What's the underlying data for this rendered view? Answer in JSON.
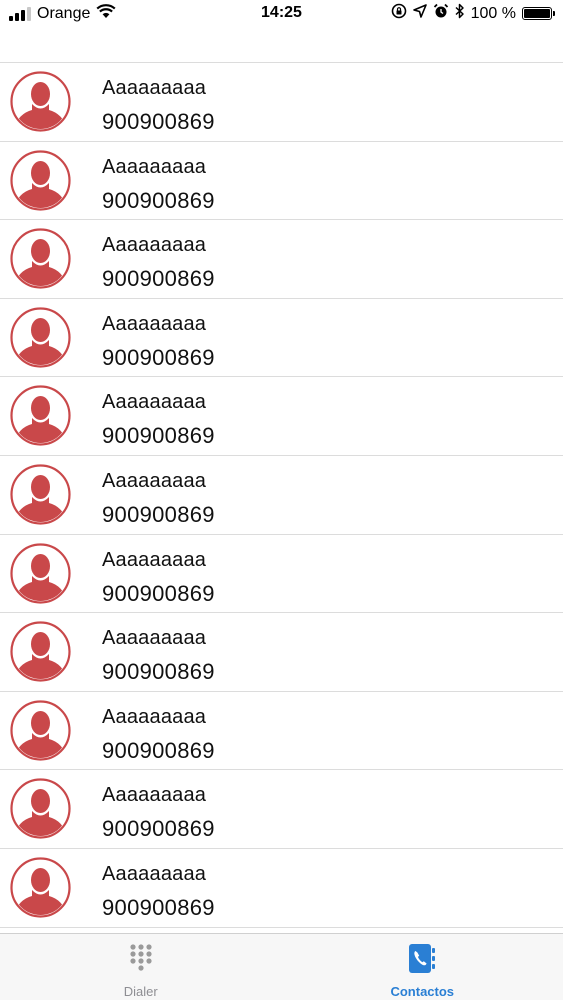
{
  "status_bar": {
    "carrier": "Orange",
    "time": "14:25",
    "battery_text": "100 %",
    "battery_level": 1.0
  },
  "contacts": [
    {
      "name": "Aaaaaaaaa",
      "phone": "900900869"
    },
    {
      "name": "Aaaaaaaaa",
      "phone": "900900869"
    },
    {
      "name": "Aaaaaaaaa",
      "phone": "900900869"
    },
    {
      "name": "Aaaaaaaaa",
      "phone": "900900869"
    },
    {
      "name": "Aaaaaaaaa",
      "phone": "900900869"
    },
    {
      "name": "Aaaaaaaaa",
      "phone": "900900869"
    },
    {
      "name": "Aaaaaaaaa",
      "phone": "900900869"
    },
    {
      "name": "Aaaaaaaaa",
      "phone": "900900869"
    },
    {
      "name": "Aaaaaaaaa",
      "phone": "900900869"
    },
    {
      "name": "Aaaaaaaaa",
      "phone": "900900869"
    },
    {
      "name": "Aaaaaaaaa",
      "phone": "900900869"
    }
  ],
  "avatar_icon": "person-placeholder-icon",
  "tab_bar": {
    "tabs": [
      {
        "label": "Dialer",
        "icon": "dialpad-icon",
        "active": false
      },
      {
        "label": "Contactos",
        "icon": "contacts-book-icon",
        "active": true
      }
    ]
  },
  "colors": {
    "avatar": "#c9484a",
    "accent": "#2a7fd4",
    "inactive": "#8e8e93",
    "separator": "#dcdcdc"
  }
}
